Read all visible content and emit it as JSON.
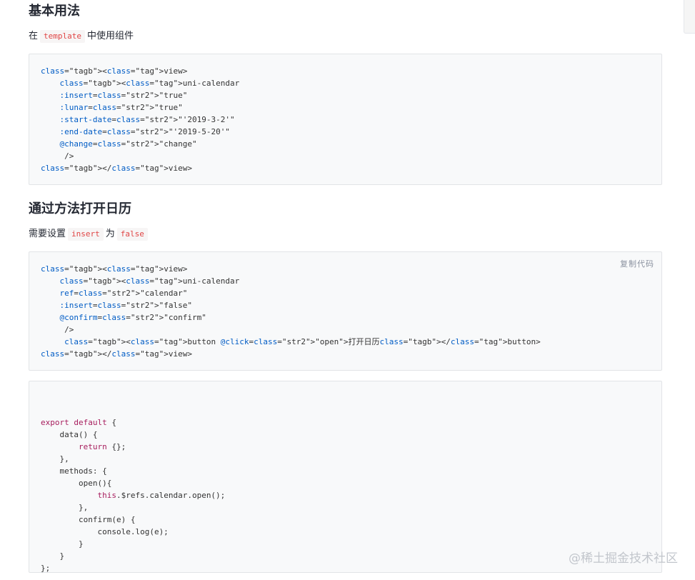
{
  "sections": [
    {
      "heading": "基本用法",
      "desc_before": "在",
      "desc_code1": "template",
      "desc_middle": "中使用组件"
    },
    {
      "heading": "通过方法打开日历",
      "desc_before": "需要设置",
      "desc_code1": "insert",
      "desc_middle": "为",
      "desc_code2": "false"
    }
  ],
  "code_blocks": {
    "basic": {
      "lines": [
        "<view>",
        "    <uni-calendar",
        "    :insert=\"true\"",
        "    :lunar=\"true\"",
        "    :start-date=\"'2019-3-2'\"",
        "    :end-date=\"'2019-5-20'\"",
        "    @change=\"change\"",
        "     />",
        "</view>"
      ]
    },
    "method_template": {
      "copy_label": "复制代码",
      "lines": [
        "<view>",
        "    <uni-calendar",
        "    ref=\"calendar\"",
        "    :insert=\"false\"",
        "    @confirm=\"confirm\"",
        "     />",
        "     <button @click=\"open\">打开日历</button>",
        "</view>"
      ]
    },
    "method_script": {
      "lines": [
        "",
        "",
        "export default {",
        "    data() {",
        "        return {};",
        "    },",
        "    methods: {",
        "        open(){",
        "            this.$refs.calendar.open();",
        "        },",
        "        confirm(e) {",
        "            console.log(e);",
        "        }",
        "    }",
        "};"
      ]
    }
  },
  "watermark": "@稀土掘金技术社区"
}
